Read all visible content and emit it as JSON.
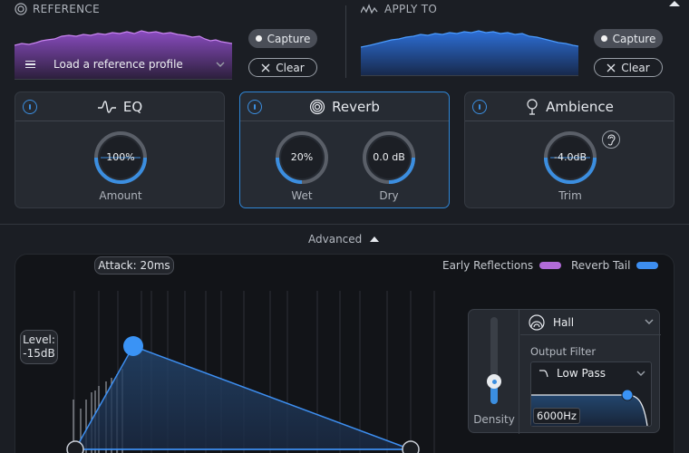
{
  "reference": {
    "title": "REFERENCE",
    "load_profile_label": "Load a reference profile",
    "capture_label": "Capture",
    "clear_label": "Clear"
  },
  "apply_to": {
    "title": "APPLY TO",
    "capture_label": "Capture",
    "clear_label": "Clear"
  },
  "modules": {
    "eq": {
      "title": "EQ",
      "knob": {
        "value_text": "100%",
        "label": "Amount",
        "value": 1.0
      }
    },
    "reverb": {
      "title": "Reverb",
      "wet": {
        "value_text": "20%",
        "label": "Wet",
        "value": 0.2
      },
      "dry": {
        "value_text": "0.0 dB",
        "label": "Dry",
        "value": 0.5
      }
    },
    "ambience": {
      "title": "Ambience",
      "trim": {
        "value_text": "-4.0dB",
        "label": "Trim",
        "value": 0.5
      }
    }
  },
  "advanced": {
    "label": "Advanced",
    "attack_label": "Attack: 20ms",
    "level_label_line1": "Level:",
    "level_label_line2": "-15dB",
    "legend": {
      "early": "Early Reflections",
      "tail": "Reverb Tail"
    },
    "density_label": "Density",
    "density_value": 0.72,
    "room_type": "Hall",
    "output_filter_label": "Output Filter",
    "filter_type": "Low Pass",
    "filter_freq": "6000Hz"
  },
  "colors": {
    "accent_blue": "#2f86d6",
    "early_purple": "#b26bd9",
    "tail_blue": "#3d8ef0",
    "reference_purple": "#8a4cc0",
    "apply_blue": "#2d6fd6"
  }
}
